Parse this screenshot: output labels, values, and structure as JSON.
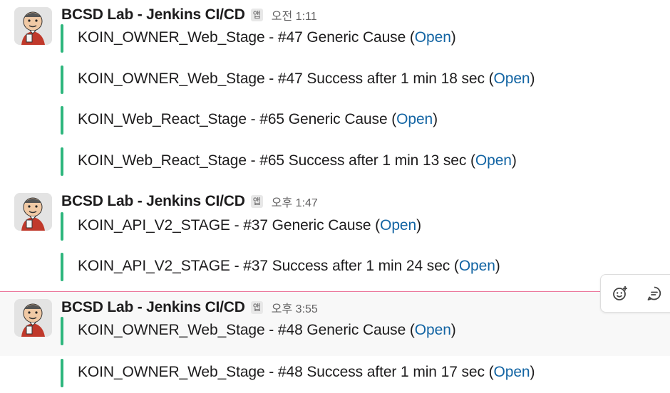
{
  "groups": [
    {
      "sender": "BCSD Lab - Jenkins CI/CD",
      "badge": "앱",
      "time": "오전 1:11",
      "attachments": [
        {
          "text": "KOIN_OWNER_Web_Stage - #47 Generic Cause (",
          "link": "Open",
          "close": ")"
        },
        {
          "text": "KOIN_OWNER_Web_Stage - #47 Success after 1 min 18 sec (",
          "link": "Open",
          "close": ")"
        },
        {
          "text": "KOIN_Web_React_Stage - #65 Generic Cause (",
          "link": "Open",
          "close": ")"
        },
        {
          "text": "KOIN_Web_React_Stage - #65 Success after 1 min 13 sec (",
          "link": "Open",
          "close": ")"
        }
      ]
    },
    {
      "sender": "BCSD Lab - Jenkins CI/CD",
      "badge": "앱",
      "time": "오후 1:47",
      "attachments": [
        {
          "text": "KOIN_API_V2_STAGE - #37 Generic Cause (",
          "link": "Open",
          "close": ")"
        },
        {
          "text": "KOIN_API_V2_STAGE - #37 Success after 1 min 24 sec (",
          "link": "Open",
          "close": ")"
        }
      ]
    },
    {
      "sender": "BCSD Lab - Jenkins CI/CD",
      "badge": "앱",
      "time": "오후 3:55",
      "attachments": [
        {
          "text": "KOIN_OWNER_Web_Stage - #48 Generic Cause (",
          "link": "Open",
          "close": ")"
        },
        {
          "text": "KOIN_OWNER_Web_Stage - #48 Success after 1 min 17 sec (",
          "link": "Open",
          "close": ")"
        }
      ]
    }
  ],
  "toolbar": {
    "icons": [
      "add-reaction-icon",
      "reply-in-thread-icon"
    ]
  },
  "colors": {
    "attachment_bar": "#2eb67d",
    "link": "#1264a3",
    "new_divider": "#e01e5a"
  }
}
